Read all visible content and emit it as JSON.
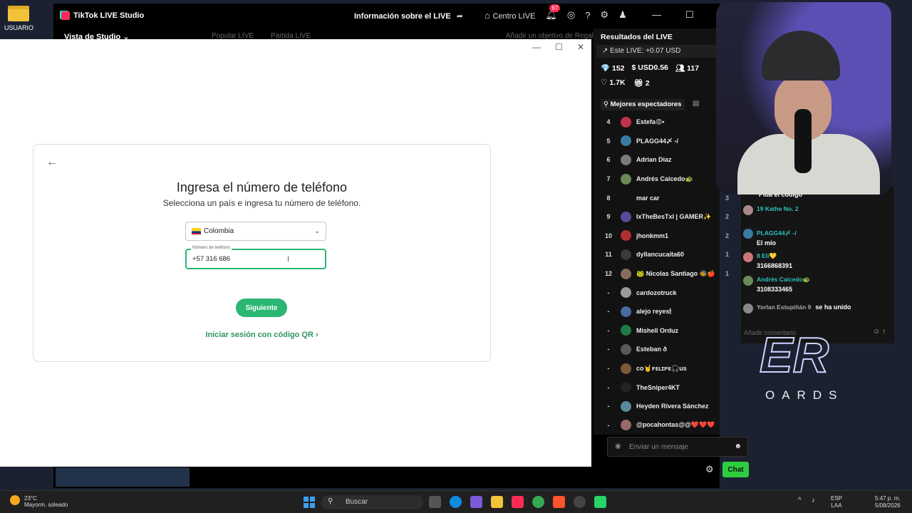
{
  "desktop": {
    "icon_label": "USUARIO"
  },
  "app": {
    "title": "TikTok LIVE Studio",
    "center_title": "Información sobre el LIVE",
    "nav_center": "Centro LIVE",
    "notif_count": "67",
    "studio_view": "Vista de Studio",
    "sub_items": [
      "Popular LIVE",
      "Partida LIVE",
      "Añadir un objetivo de Regalos"
    ]
  },
  "modal": {
    "title": "Ingresa el número de teléfono",
    "subtitle": "Selecciona un país e ingresa tu número de teléfono.",
    "country": "Colombia",
    "phone_label": "Número de teléfono",
    "phone_value": "+57 316 686",
    "next_button": "Siguiente",
    "qr_link": "Iniciar sesión con código QR"
  },
  "results": {
    "title": "Resultados del LIVE",
    "this_live": "Este LIVE: +0.07 USD",
    "stats": [
      "152",
      "USD0.56",
      "117"
    ],
    "stats2": [
      "1.7K",
      "2"
    ],
    "top_viewers_label": "Mejores espectadores",
    "viewers": [
      {
        "rank": "4",
        "name": "Estefa😡•",
        "score": "",
        "color": "#c0334b"
      },
      {
        "rank": "5",
        "name": "PLAGG44〆 -/",
        "score": "",
        "color": "#3b7aa3"
      },
      {
        "rank": "6",
        "name": "Adrian Diaz",
        "score": "",
        "color": "#7a7a7a"
      },
      {
        "rank": "7",
        "name": "Andrés Caicedo🐢",
        "score": "",
        "color": "#6a8a5a"
      },
      {
        "rank": "8",
        "name": "mar car",
        "score": "3",
        "color": "#111111"
      },
      {
        "rank": "9",
        "name": "IxTheBesTxI | GAMER✨",
        "score": "2",
        "color": "#5a4a9a"
      },
      {
        "rank": "10",
        "name": "jhonkmm1",
        "score": "2",
        "color": "#b03030"
      },
      {
        "rank": "11",
        "name": "dyllancucaita60",
        "score": "1",
        "color": "#3a3a3a"
      },
      {
        "rank": "12",
        "name": "🐸 Nicolas Santiago 🐝🍎",
        "score": "1",
        "color": "#8a6a5a"
      },
      {
        "rank": "-",
        "name": "cardozotruck",
        "score": "",
        "color": "#9a9a9a"
      },
      {
        "rank": "-",
        "name": "alejo reyes🕯",
        "score": "",
        "color": "#4a6aa0"
      },
      {
        "rank": "-",
        "name": "Mishell Orduz",
        "score": "",
        "color": "#1f7a4a"
      },
      {
        "rank": "-",
        "name": "Esteban ð",
        "score": "",
        "color": "#5a5a5a"
      },
      {
        "rank": "-",
        "name": "co🤘ꜰᴇʟɪᴘᴇ🎧us",
        "score": "",
        "color": "#7a5a3a"
      },
      {
        "rank": "-",
        "name": "TheSniper4KT",
        "score": "",
        "color": "#222222"
      },
      {
        "rank": "-",
        "name": "Heyden Rivera Sánchez",
        "score": "",
        "color": "#5a8a9a"
      },
      {
        "rank": "-",
        "name": "@pocahontas@@❤️❤️❤️",
        "score": "",
        "color": "#9a6a6a"
      }
    ]
  },
  "chat": {
    "messages": [
      {
        "name": "",
        "text": "Pida el código"
      },
      {
        "name": "19 Kathe No. 2",
        "text": ""
      },
      {
        "name": "PLAGG44〆 -/",
        "text": "El mío"
      },
      {
        "name": "8 Eli💛",
        "text": "3166868391"
      },
      {
        "name": "Andrés Caicedo🐢",
        "text": "3108333465"
      },
      {
        "name": "Yorlan Estupiñán 9",
        "text": "se ha unido"
      }
    ],
    "input_placeholder": "Añadir comentario"
  },
  "overlay": {
    "big": "ER",
    "small": "OARDS"
  },
  "message_bar": {
    "placeholder": "Enviar un mensaje",
    "chat_button": "Chat"
  },
  "taskbar": {
    "temp": "23°C",
    "weather": "Mayorm. soleado",
    "search": "Buscar",
    "lang1": "ESP",
    "lang2": "LAA",
    "time": "5:47 p. m.",
    "date": "5/08/2026"
  },
  "colors": {
    "accent_green": "#2bb673",
    "tiktok_pink": "#fe2c55",
    "chat_green": "#2ecc40"
  }
}
